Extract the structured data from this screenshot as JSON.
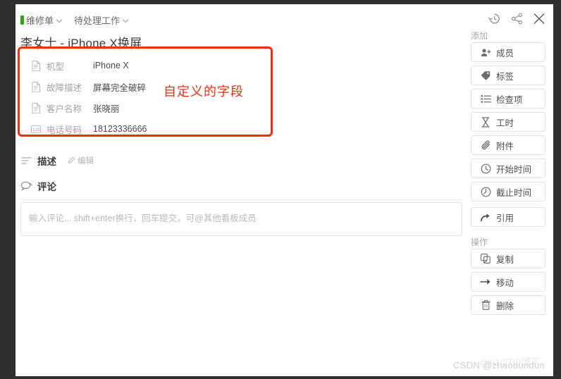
{
  "breadcrumb": [
    {
      "label": "维修单",
      "has_marker": true,
      "has_caret": true
    },
    {
      "label": "待处理工作",
      "has_marker": false,
      "has_caret": true
    }
  ],
  "card": {
    "title": "李女士 - iPhone X换屏"
  },
  "annotation": {
    "text": "自定义的字段",
    "color": "#f42d10"
  },
  "custom_fields": [
    {
      "icon": "document-icon",
      "label": "机型",
      "value": "iPhone X"
    },
    {
      "icon": "document-icon",
      "label": "故障描述",
      "value": "屏幕完全破碎"
    },
    {
      "icon": "document-icon",
      "label": "客户名称",
      "value": "张晓丽"
    },
    {
      "icon": "number-icon",
      "label": "电话号码",
      "value": "18123336666"
    }
  ],
  "description": {
    "title": "描述",
    "edit_label": "编辑"
  },
  "comment": {
    "title": "评论",
    "placeholder": "输入评论... shift+enter换行，回车提交，可@其他看板成员",
    "value": ""
  },
  "sidebar": {
    "top_icons": [
      {
        "name": "history-icon"
      },
      {
        "name": "share-icon"
      },
      {
        "name": "close-icon"
      }
    ],
    "add_group_label": "添加",
    "add_items": [
      {
        "icon": "member-add-icon",
        "label": "成员"
      },
      {
        "icon": "tag-icon",
        "label": "标签"
      },
      {
        "icon": "checklist-icon",
        "label": "检查项"
      },
      {
        "icon": "hourglass-icon",
        "label": "工时"
      },
      {
        "icon": "paperclip-icon",
        "label": "附件"
      },
      {
        "icon": "clock-start-icon",
        "label": "开始时间"
      },
      {
        "icon": "clock-due-icon",
        "label": "截止时间"
      },
      {
        "icon": "quote-arrow-icon",
        "label": "引用"
      }
    ],
    "ops_group_label": "操作",
    "ops_items": [
      {
        "icon": "copy-icon",
        "label": "复制"
      },
      {
        "icon": "arrow-right-icon",
        "label": "移动"
      },
      {
        "icon": "trash-icon",
        "label": "删除"
      }
    ]
  },
  "watermark": {
    "text": "CSDN @zhaodundun",
    "ghost_text": "@51CTO博客"
  }
}
